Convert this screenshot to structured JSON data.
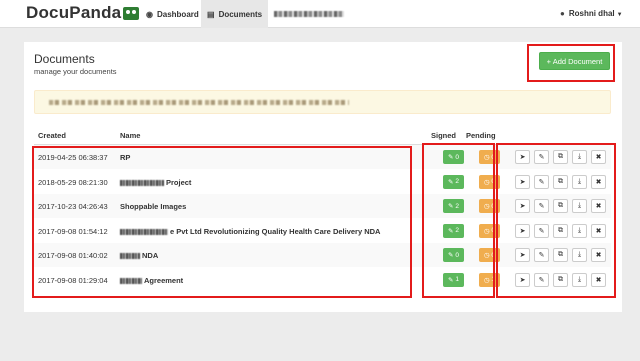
{
  "nav": {
    "brand": "DocuPanda",
    "dashboard": "Dashboard",
    "documents": "Documents",
    "user": "Roshni dhal"
  },
  "page": {
    "title": "Documents",
    "subtitle": "manage your documents",
    "add_button": "+ Add Document"
  },
  "table": {
    "headers": {
      "created": "Created",
      "name": "Name",
      "signed": "Signed",
      "pending": "Pending"
    },
    "rows": [
      {
        "created": "2019-04-25 06:38:37",
        "name": "RP",
        "signed": "0",
        "pending": "0"
      },
      {
        "created": "2018-05-29 08:21:30",
        "name": "Project",
        "signed": "2",
        "pending": "0"
      },
      {
        "created": "2017-10-23 04:26:43",
        "name": "Shoppable Images",
        "signed": "2",
        "pending": "0"
      },
      {
        "created": "2017-09-08 01:54:12",
        "name": "e Pvt Ltd Revolutionizing Quality Health Care Delivery NDA",
        "signed": "2",
        "pending": "0"
      },
      {
        "created": "2017-09-08 01:40:02",
        "name": "NDA",
        "signed": "0",
        "pending": "0"
      },
      {
        "created": "2017-09-08 01:29:04",
        "name": "Agreement",
        "signed": "1",
        "pending": "1"
      }
    ]
  },
  "icons": {
    "signed_badge": "edit-icon",
    "pending_badge": "clock-icon",
    "actions": [
      "send-icon",
      "edit-icon",
      "copy-icon",
      "download-icon",
      "trash-icon"
    ]
  },
  "colors": {
    "success": "#5cb85c",
    "warning": "#f0ad4e",
    "highlight": "#e31b1b",
    "alert_bg": "#fcf8e3"
  }
}
